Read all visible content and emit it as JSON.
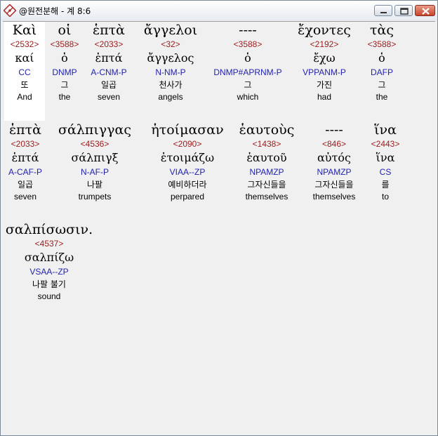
{
  "window": {
    "title": "@원전분해 - 계 8:6"
  },
  "words": [
    {
      "greek": "Καὶ",
      "strong": "<2532>",
      "lemma": "καί",
      "parse": "CC",
      "korean": "또",
      "english": "And"
    },
    {
      "greek": "οἱ",
      "strong": "<3588>",
      "lemma": "ὁ",
      "parse": "DNMP",
      "korean": "그",
      "english": "the"
    },
    {
      "greek": "ἑπτὰ",
      "strong": "<2033>",
      "lemma": "ἑπτά",
      "parse": "A-CNM-P",
      "korean": "일곱",
      "english": "seven"
    },
    {
      "greek": "ἄγγελοι",
      "strong": "<32>",
      "lemma": "ἄγγελος",
      "parse": "N-NM-P",
      "korean": "천사가",
      "english": "angels"
    },
    {
      "greek": "----",
      "strong": "<3588>",
      "lemma": "ὁ",
      "parse": "DNMP#APRNM-P",
      "korean": "그",
      "english": "which"
    },
    {
      "greek": "ἔχοντες",
      "strong": "<2192>",
      "lemma": "ἔχω",
      "parse": "VPPANM-P",
      "korean": "가진",
      "english": "had"
    },
    {
      "greek": "τὰς",
      "strong": "<3588>",
      "lemma": "ὁ",
      "parse": "DAFP",
      "korean": "그",
      "english": "the"
    },
    {
      "greek": "ἑπτὰ",
      "strong": "<2033>",
      "lemma": "ἑπτά",
      "parse": "A-CAF-P",
      "korean": "일곱",
      "english": "seven"
    },
    {
      "greek": "σάλπιγγας",
      "strong": "<4536>",
      "lemma": "σάλπιγξ",
      "parse": "N-AF-P",
      "korean": "나팔",
      "english": "trumpets"
    },
    {
      "greek": "ἡτοίμασαν",
      "strong": "<2090>",
      "lemma": "ἑτοιμάζω",
      "parse": "VIAA--ZP",
      "korean": "예비하더라",
      "english": "perpared"
    },
    {
      "greek": "ἑαυτοὺς",
      "strong": "<1438>",
      "lemma": "ἑαυτοῦ",
      "parse": "NPAMZP",
      "korean": "그자신들을",
      "english": "themselves"
    },
    {
      "greek": "----",
      "strong": "<846>",
      "lemma": "αὐτός",
      "parse": "NPAMZP",
      "korean": "그자신들을",
      "english": "themselves"
    },
    {
      "greek": "ἵνα",
      "strong": "<2443>",
      "lemma": "ἵνα",
      "parse": "CS",
      "korean": "를",
      "english": "to"
    },
    {
      "greek": "σαλπίσωσιν.",
      "strong": "<4537>",
      "lemma": "σαλπίζω",
      "parse": "VSAA--ZP",
      "korean": "나팔 불기",
      "english": "sound"
    }
  ]
}
